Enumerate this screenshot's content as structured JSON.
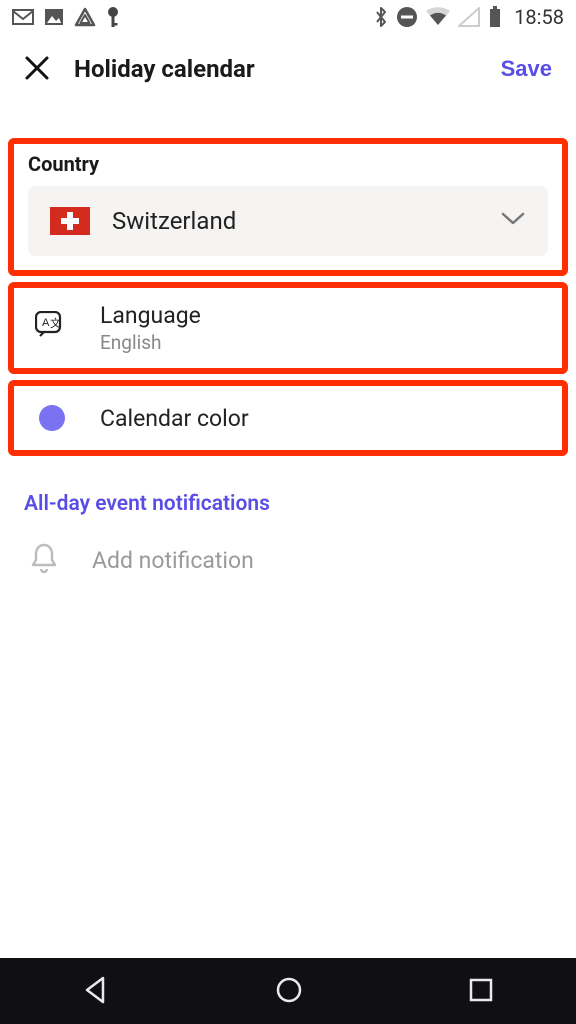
{
  "status": {
    "time": "18:58"
  },
  "header": {
    "title": "Holiday calendar",
    "save_label": "Save"
  },
  "country": {
    "label": "Country",
    "selected": "Switzerland"
  },
  "language": {
    "label": "Language",
    "value": "English"
  },
  "color": {
    "label": "Calendar color",
    "hex": "#7b72f2"
  },
  "notifications": {
    "heading": "All-day event notifications",
    "add_label": "Add notification"
  },
  "accent": "#5a4de6",
  "highlight": "#ff2d00"
}
